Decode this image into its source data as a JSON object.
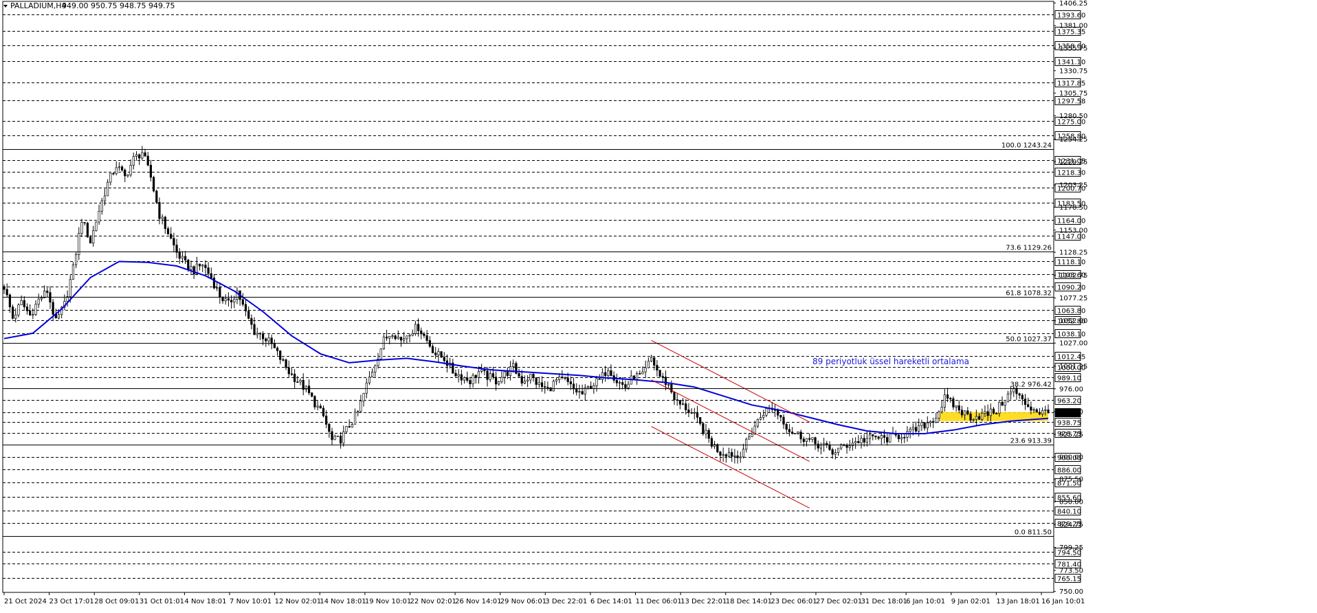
{
  "header": {
    "symbol": "PALLADIUM,H4",
    "ohlc": "949.00 950.75 948.75 949.75"
  },
  "annotation": {
    "text": "89 periyotluk üssel hareketli ortalama",
    "color": "#1a1adc"
  },
  "colors": {
    "ma": "#0000dd",
    "channel": "#c80000",
    "zone": "#ffd700",
    "candle": "#000000",
    "grid": "#000000"
  },
  "chart_data": {
    "type": "candlestick",
    "symbol": "PALLADIUM",
    "timeframe": "H4",
    "ylim": [
      749,
      1408
    ],
    "y_ticks": [
      "1406.25",
      "1381.00",
      "1355.75",
      "1330.75",
      "1305.75",
      "1280.50",
      "1254.25",
      "1229.25",
      "1203.25",
      "1178.50",
      "1153.00",
      "1128.25",
      "1102.75",
      "1077.25",
      "1052.00",
      "1027.00",
      "1001.25",
      "976.00",
      "950.50",
      "925.25",
      "900.00",
      "875.50",
      "850.00",
      "824.75",
      "799.25",
      "773.50",
      "750.00"
    ],
    "x_ticks": [
      "21 Oct 2024",
      "23 Oct 17:01",
      "28 Oct 09:01",
      "31 Oct 01:01",
      "4 Nov 18:01",
      "7 Nov 10:01",
      "12 Nov 02:01",
      "14 Nov 18:01",
      "19 Nov 10:01",
      "22 Nov 02:01",
      "26 Nov 14:01",
      "29 Nov 06:01",
      "3 Dec 22:01",
      "6 Dec 14:01",
      "11 Dec 06:01",
      "13 Dec 22:01",
      "18 Dec 14:01",
      "23 Dec 06:01",
      "27 Dec 02:01",
      "31 Dec 18:01",
      "6 Jan 10:01",
      "9 Jan 02:01",
      "13 Jan 18:01",
      "16 Jan 10:01"
    ],
    "horizontal_levels": [
      1393.6,
      1375.35,
      1358.6,
      1341.1,
      1317.85,
      1297.58,
      1275.0,
      1258.8,
      1231.05,
      1218.3,
      1200.7,
      1183.5,
      1164.0,
      1147.0,
      1118.1,
      1103.6,
      1090.2,
      1063.8,
      1052.8,
      1038.1,
      1012.45,
      1000.0,
      989.1,
      963.2,
      949.75,
      938.75,
      926.75,
      900.0,
      886.0,
      871.5,
      855.6,
      840.1,
      826.25,
      794.5,
      781.4,
      765.15
    ],
    "level_labels": [
      "1393.60",
      "1375.35",
      "1358.60",
      "1341.10",
      "1317.85",
      "1297.58",
      "1275.00",
      "1258.80",
      "1231.05",
      "1218.30",
      "1200.70",
      "1183.50",
      "1164.00",
      "1147.00",
      "1118.10",
      "1103.60",
      "1090.20",
      "1063.80",
      "1052.80",
      "1038.10",
      "1012.45",
      "1000.00",
      "989.10",
      "963.20",
      "949.75",
      "938.75",
      "926.75",
      "900.00",
      "886.00",
      "871.50",
      "855.60",
      "840.10",
      "826.25",
      "794.50",
      "781.40",
      "765.15"
    ],
    "current_price": 949.75,
    "fibonacci": [
      {
        "label": "100.0 1243.24",
        "value": 1243.24
      },
      {
        "label": "73.6 1129.26",
        "value": 1129.26
      },
      {
        "label": "61.8 1078.32",
        "value": 1078.32
      },
      {
        "label": "50.0 1027.37",
        "value": 1027.37
      },
      {
        "label": "38.2 976.42",
        "value": 976.42
      },
      {
        "label": "23.6 913.39",
        "value": 913.39
      },
      {
        "label": "0.0 811.50",
        "value": 811.5
      }
    ],
    "close_path": [
      [
        0,
        1090
      ],
      [
        3,
        1055
      ],
      [
        6,
        1072
      ],
      [
        9,
        1058
      ],
      [
        12,
        1075
      ],
      [
        15,
        1085
      ],
      [
        18,
        1050
      ],
      [
        21,
        1070
      ],
      [
        24,
        1110
      ],
      [
        27,
        1165
      ],
      [
        30,
        1140
      ],
      [
        33,
        1175
      ],
      [
        36,
        1205
      ],
      [
        39,
        1225
      ],
      [
        42,
        1212
      ],
      [
        45,
        1232
      ],
      [
        48,
        1240
      ],
      [
        51,
        1212
      ],
      [
        54,
        1170
      ],
      [
        57,
        1150
      ],
      [
        60,
        1128
      ],
      [
        63,
        1115
      ],
      [
        66,
        1108
      ],
      [
        69,
        1115
      ],
      [
        72,
        1100
      ],
      [
        75,
        1080
      ],
      [
        78,
        1070
      ],
      [
        81,
        1085
      ],
      [
        84,
        1060
      ],
      [
        87,
        1040
      ],
      [
        90,
        1035
      ],
      [
        93,
        1025
      ],
      [
        96,
        1010
      ],
      [
        99,
        995
      ],
      [
        102,
        985
      ],
      [
        105,
        975
      ],
      [
        108,
        960
      ],
      [
        111,
        945
      ],
      [
        114,
        918
      ],
      [
        117,
        920
      ],
      [
        120,
        935
      ],
      [
        123,
        950
      ],
      [
        126,
        980
      ],
      [
        129,
        1005
      ],
      [
        132,
        1030
      ],
      [
        135,
        1040
      ],
      [
        138,
        1030
      ],
      [
        141,
        1040
      ],
      [
        144,
        1045
      ],
      [
        147,
        1030
      ],
      [
        150,
        1015
      ],
      [
        153,
        1010
      ],
      [
        156,
        995
      ],
      [
        159,
        990
      ],
      [
        162,
        985
      ],
      [
        165,
        995
      ],
      [
        168,
        990
      ],
      [
        171,
        985
      ],
      [
        174,
        992
      ],
      [
        177,
        1000
      ],
      [
        180,
        985
      ],
      [
        183,
        990
      ],
      [
        186,
        980
      ],
      [
        189,
        975
      ],
      [
        192,
        985
      ],
      [
        195,
        985
      ],
      [
        198,
        975
      ],
      [
        201,
        970
      ],
      [
        204,
        980
      ],
      [
        207,
        985
      ],
      [
        210,
        1000
      ],
      [
        213,
        985
      ],
      [
        216,
        978
      ],
      [
        219,
        990
      ],
      [
        222,
        990
      ],
      [
        225,
        1010
      ],
      [
        228,
        990
      ],
      [
        231,
        980
      ],
      [
        234,
        960
      ],
      [
        237,
        955
      ],
      [
        240,
        945
      ],
      [
        243,
        930
      ],
      [
        246,
        915
      ],
      [
        249,
        905
      ],
      [
        252,
        905
      ],
      [
        255,
        900
      ],
      [
        258,
        915
      ],
      [
        261,
        935
      ],
      [
        264,
        950
      ],
      [
        267,
        955
      ],
      [
        270,
        945
      ],
      [
        273,
        930
      ],
      [
        276,
        925
      ],
      [
        279,
        920
      ],
      [
        282,
        915
      ],
      [
        285,
        912
      ],
      [
        288,
        905
      ],
      [
        291,
        910
      ],
      [
        294,
        915
      ],
      [
        297,
        918
      ],
      [
        300,
        920
      ],
      [
        303,
        922
      ],
      [
        306,
        920
      ],
      [
        309,
        922
      ],
      [
        312,
        925
      ],
      [
        315,
        927
      ],
      [
        318,
        932
      ],
      [
        321,
        938
      ],
      [
        324,
        945
      ],
      [
        327,
        965
      ],
      [
        330,
        958
      ],
      [
        333,
        950
      ],
      [
        336,
        945
      ],
      [
        339,
        946
      ],
      [
        342,
        948
      ],
      [
        345,
        952
      ],
      [
        348,
        965
      ],
      [
        351,
        975
      ],
      [
        354,
        962
      ],
      [
        357,
        955
      ],
      [
        360,
        950
      ],
      [
        363,
        949.75
      ]
    ],
    "ma_89": [
      [
        0,
        1032
      ],
      [
        10,
        1038
      ],
      [
        20,
        1065
      ],
      [
        30,
        1100
      ],
      [
        40,
        1118
      ],
      [
        50,
        1117
      ],
      [
        60,
        1113
      ],
      [
        70,
        1102
      ],
      [
        80,
        1085
      ],
      [
        90,
        1062
      ],
      [
        100,
        1035
      ],
      [
        110,
        1015
      ],
      [
        120,
        1005
      ],
      [
        130,
        1008
      ],
      [
        140,
        1010
      ],
      [
        150,
        1006
      ],
      [
        160,
        1001
      ],
      [
        170,
        997
      ],
      [
        180,
        995
      ],
      [
        190,
        993
      ],
      [
        200,
        991
      ],
      [
        210,
        988
      ],
      [
        220,
        986
      ],
      [
        230,
        983
      ],
      [
        240,
        978
      ],
      [
        250,
        968
      ],
      [
        260,
        958
      ],
      [
        270,
        952
      ],
      [
        280,
        944
      ],
      [
        290,
        936
      ],
      [
        300,
        929
      ],
      [
        310,
        926
      ],
      [
        320,
        926
      ],
      [
        330,
        930
      ],
      [
        340,
        936
      ],
      [
        350,
        940
      ],
      [
        363,
        943
      ]
    ],
    "channel_lines": [
      [
        [
          225,
          1030
        ],
        [
          280,
          939
        ]
      ],
      [
        [
          225,
          986
        ],
        [
          280,
          895
        ]
      ],
      [
        [
          225,
          934
        ],
        [
          280,
          843
        ]
      ]
    ],
    "zone": {
      "x": [
        325,
        363
      ],
      "low": 940,
      "high": 950
    }
  }
}
